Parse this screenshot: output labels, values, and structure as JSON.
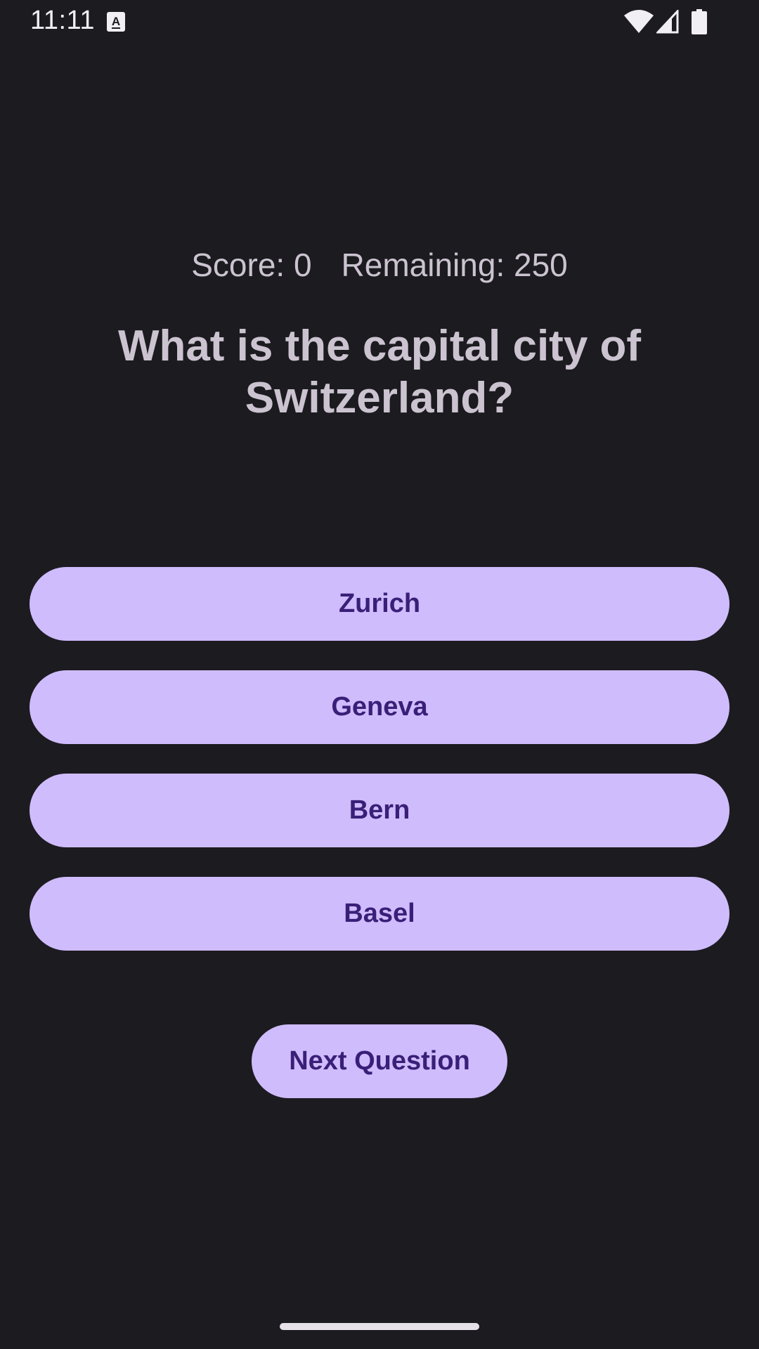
{
  "status_bar": {
    "time": "11:11",
    "icons": [
      "keyboard-a-icon",
      "wifi-icon",
      "signal-icon",
      "battery-icon"
    ]
  },
  "scoreboard": {
    "score_text": "Score: 0",
    "remaining_text": "Remaining: 250"
  },
  "question": {
    "text": "What is the capital city of Switzerland?"
  },
  "answers": [
    {
      "label": "Zurich"
    },
    {
      "label": "Geneva"
    },
    {
      "label": "Bern"
    },
    {
      "label": "Basel"
    }
  ],
  "next_button": {
    "label": "Next Question"
  },
  "colors": {
    "background": "#1c1b20",
    "button_bg": "#cfbcfd",
    "button_text": "#3a1f78",
    "text": "#cbc4d0"
  }
}
